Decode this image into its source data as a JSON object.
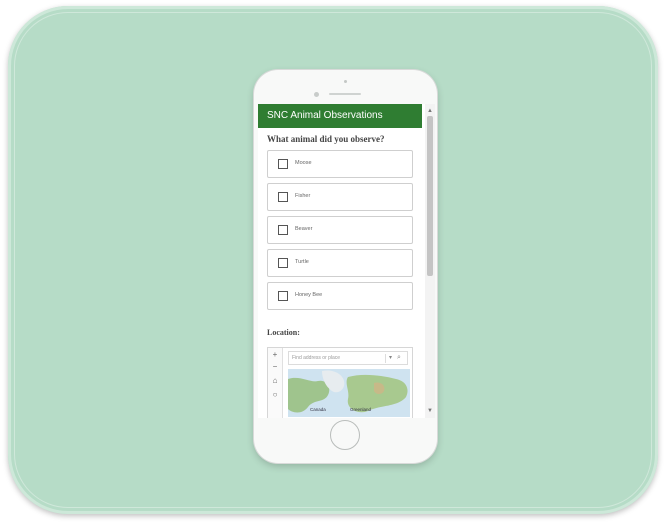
{
  "app": {
    "title": "SNC Animal Observations",
    "accent_color": "#2f7d32"
  },
  "survey": {
    "question": "What animal did you observe?",
    "options": [
      {
        "label": "Moose",
        "checked": false
      },
      {
        "label": "Fisher",
        "checked": false
      },
      {
        "label": "Beaver",
        "checked": false
      },
      {
        "label": "Turtle",
        "checked": false
      },
      {
        "label": "Honey Bee",
        "checked": false
      }
    ]
  },
  "location": {
    "label": "Location:",
    "search_placeholder": "Find address or place",
    "tool_icons": [
      "plus-icon",
      "minus-icon",
      "home-icon",
      "locate-icon"
    ],
    "map_labels": [
      "Canada",
      "Greenland"
    ]
  },
  "scrollbar": {
    "icons": [
      "scroll-up-arrow-icon",
      "scroll-down-arrow-icon"
    ]
  }
}
